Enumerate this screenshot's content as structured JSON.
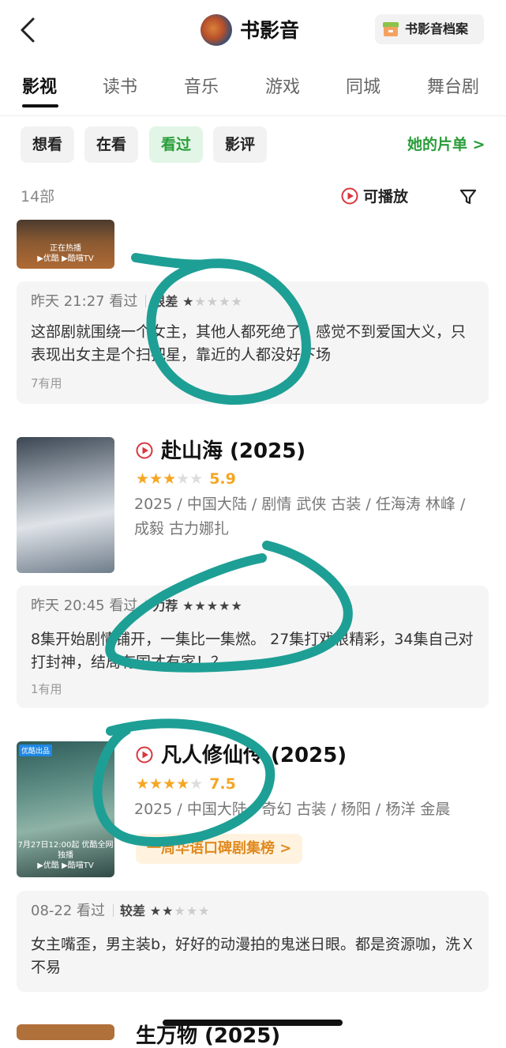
{
  "header": {
    "title": "书影音",
    "archive_label": "书影音档案"
  },
  "tabs": [
    {
      "label": "影视",
      "active": true
    },
    {
      "label": "读书"
    },
    {
      "label": "音乐"
    },
    {
      "label": "游戏"
    },
    {
      "label": "同城"
    },
    {
      "label": "舞台剧"
    }
  ],
  "chips": [
    {
      "label": "想看"
    },
    {
      "label": "在看"
    },
    {
      "label": "看过",
      "active": true
    },
    {
      "label": "影评"
    }
  ],
  "her_list": "她的片单 >",
  "count": "14部",
  "playable": "可播放",
  "items": [
    {
      "poster_caption_1": "正在热播",
      "poster_caption_2": "▶优酷 ▶酷喵TV",
      "review": {
        "time": "昨天 21:27 看过",
        "label": "很差",
        "stars": 1,
        "text": "这部剧就围绕一个女主，其他人都死绝了。感觉不到爱国大义，只表现出女主是个扫把星，靠近的人都没好下场",
        "helpful": "7有用"
      }
    },
    {
      "title": "赴山海 (2025)",
      "rating_stars": 3,
      "score": "5.9",
      "desc": "2025 / 中国大陆 / 剧情 武侠 古装 / 任海涛 林峰 / 成毅 古力娜扎",
      "review": {
        "time": "昨天 20:45 看过",
        "label": "力荐",
        "stars": 5,
        "text": "8集开始剧情铺开，一集比一集燃。 27集打戏很精彩，34集自己对打封神，结局有国才有家！？",
        "helpful": "1有用"
      }
    },
    {
      "title": "凡人修仙传 (2025)",
      "rating_stars": 4,
      "score": "7.5",
      "desc": "2025 / 中国大陆 / 奇幻 古装 / 杨阳 / 杨洋 金晨",
      "rank_badge": "一周华语口碑剧集榜 >",
      "poster_badge": "优酷出品",
      "poster_caption_1": "7月27日12:00起 优酷全网独播",
      "poster_caption_2": "▶优酷 ▶酷喵TV",
      "review": {
        "time": "08-22 看过",
        "label": "较差",
        "stars": 2,
        "text": "女主嘴歪，男主装b，好好的动漫拍的鬼迷日眼。都是资源咖，洗Ｘ不易"
      }
    }
  ],
  "next_item_title": "生万物 (2025)",
  "colors": {
    "accent_green": "#2a9d3a",
    "star_orange": "#f5a623",
    "annotation_teal": "#1e9f95",
    "play_red": "#d9363e"
  }
}
